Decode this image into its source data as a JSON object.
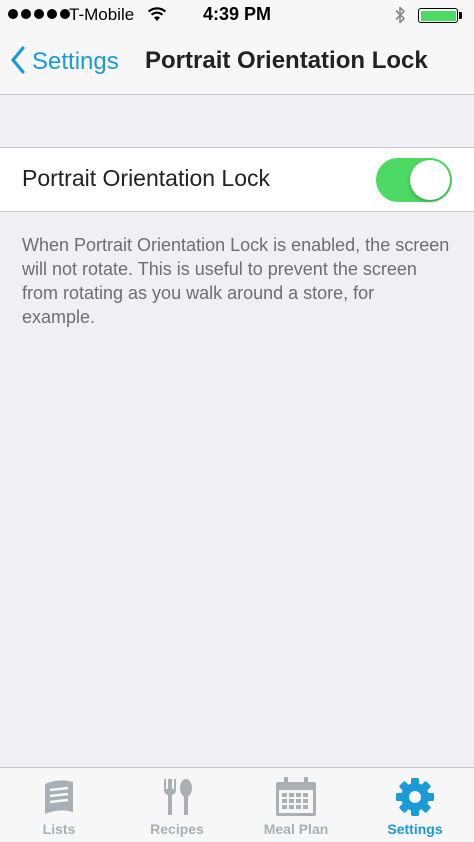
{
  "status_bar": {
    "carrier": "T-Mobile",
    "time": "4:39 PM",
    "battery_level": 1.0
  },
  "nav": {
    "back_label": "Settings",
    "title": "Portrait Orientation Lock"
  },
  "setting": {
    "label": "Portrait Orientation Lock",
    "enabled": true
  },
  "description": "When Portrait Orientation Lock is enabled, the screen will not rotate. This is useful to prevent the screen from rotating as you walk around a store, for example.",
  "colors": {
    "accent": "#1a9ad6",
    "toggle_on": "#4cd964",
    "tab_inactive": "#a8b0b6"
  },
  "tabs": [
    {
      "label": "Lists",
      "icon": "lists-icon",
      "active": false
    },
    {
      "label": "Recipes",
      "icon": "fork-spoon-icon",
      "active": false
    },
    {
      "label": "Meal Plan",
      "icon": "calendar-icon",
      "active": false
    },
    {
      "label": "Settings",
      "icon": "gear-icon",
      "active": true
    }
  ]
}
